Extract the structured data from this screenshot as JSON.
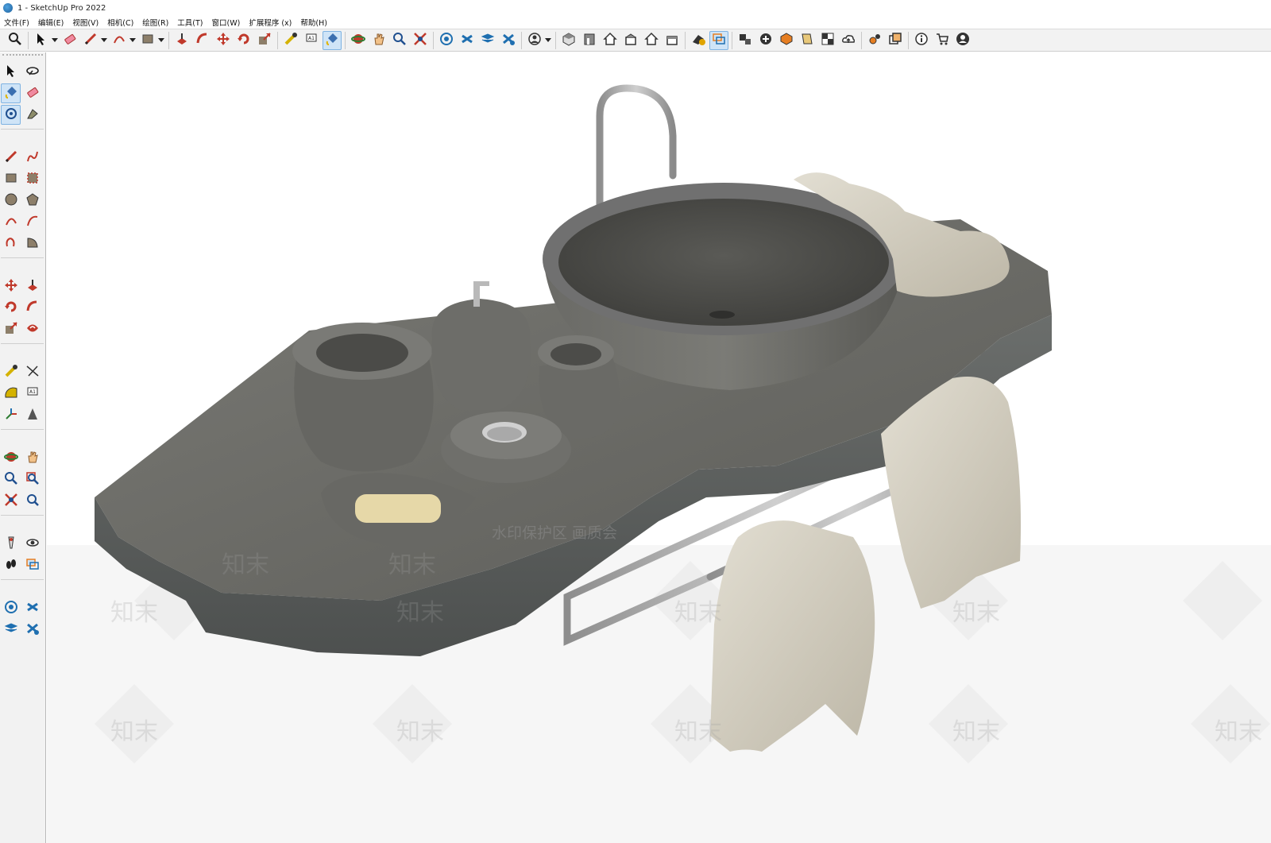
{
  "window": {
    "title": "1 - SketchUp Pro 2022"
  },
  "menu": [
    {
      "label": "文件(F)"
    },
    {
      "label": "编辑(E)"
    },
    {
      "label": "视图(V)"
    },
    {
      "label": "相机(C)"
    },
    {
      "label": "绘图(R)"
    },
    {
      "label": "工具(T)"
    },
    {
      "label": "窗口(W)"
    },
    {
      "label": "扩展程序 (x)"
    },
    {
      "label": "帮助(H)"
    }
  ],
  "toolbar": {
    "buttons": [
      {
        "icon": "zoom-search-icon"
      },
      {
        "icon": "select-arrow-icon",
        "dropdown": true
      },
      {
        "icon": "eraser-icon"
      },
      {
        "icon": "pencil-line-icon",
        "dropdown": true
      },
      {
        "icon": "arc-icon",
        "dropdown": true
      },
      {
        "icon": "rectangle-icon",
        "dropdown": true
      },
      {
        "icon": "push-pull-icon"
      },
      {
        "icon": "follow-me-icon"
      },
      {
        "icon": "move-icon"
      },
      {
        "icon": "rotate-icon"
      },
      {
        "icon": "scale-icon"
      },
      {
        "icon": "tape-measure-icon"
      },
      {
        "icon": "text-label-icon"
      },
      {
        "icon": "paint-bucket-icon",
        "active": true
      },
      {
        "icon": "orbit-icon"
      },
      {
        "icon": "pan-icon"
      },
      {
        "icon": "zoom-icon"
      },
      {
        "icon": "zoom-extents-icon"
      },
      {
        "icon": "warehouse-icon"
      },
      {
        "icon": "extension-warehouse-icon"
      },
      {
        "icon": "layout-icon"
      },
      {
        "icon": "extension-manager-icon"
      },
      {
        "icon": "account-icon",
        "dropdown": true
      },
      {
        "icon": "iso-view-icon"
      },
      {
        "icon": "front-view-icon"
      },
      {
        "icon": "top-view-icon"
      },
      {
        "icon": "right-view-icon"
      },
      {
        "icon": "back-view-icon"
      },
      {
        "icon": "left-view-icon"
      },
      {
        "icon": "xray-icon"
      },
      {
        "icon": "section-plane-icon",
        "active": true
      },
      {
        "icon": "section-display-icon"
      },
      {
        "icon": "add-location-icon"
      },
      {
        "icon": "terrain-icon"
      },
      {
        "icon": "photo-texture-icon"
      },
      {
        "icon": "checker-icon"
      },
      {
        "icon": "cloud-upload-icon"
      },
      {
        "icon": "settings-gear-icon"
      },
      {
        "icon": "window-icon"
      },
      {
        "icon": "info-icon"
      },
      {
        "icon": "cart-icon"
      },
      {
        "icon": "user-icon"
      }
    ]
  },
  "left_tools": [
    {
      "icon": "select-arrow-icon"
    },
    {
      "icon": "orbit-lasso-icon"
    },
    {
      "icon": "paint-bucket-icon",
      "active": true
    },
    {
      "icon": "eraser-icon"
    },
    {
      "icon": "component-icon",
      "active": true
    },
    {
      "icon": "tag-icon"
    },
    {
      "sep": true
    },
    {
      "icon": "pencil-line-icon"
    },
    {
      "icon": "freehand-icon"
    },
    {
      "icon": "rectangle-icon"
    },
    {
      "icon": "rotated-rectangle-icon"
    },
    {
      "icon": "circle-icon"
    },
    {
      "icon": "polygon-icon"
    },
    {
      "icon": "arc-icon"
    },
    {
      "icon": "two-point-arc-icon"
    },
    {
      "icon": "three-point-arc-icon"
    },
    {
      "icon": "pie-icon"
    },
    {
      "sep": true
    },
    {
      "icon": "move-icon"
    },
    {
      "icon": "push-pull-icon"
    },
    {
      "icon": "rotate-icon"
    },
    {
      "icon": "follow-me-icon"
    },
    {
      "icon": "scale-icon"
    },
    {
      "icon": "offset-icon"
    },
    {
      "sep": true
    },
    {
      "icon": "tape-measure-icon"
    },
    {
      "icon": "dimension-icon"
    },
    {
      "icon": "protractor-icon"
    },
    {
      "icon": "text-label-icon"
    },
    {
      "icon": "axes-icon"
    },
    {
      "icon": "3d-text-icon"
    },
    {
      "sep": true
    },
    {
      "icon": "orbit-icon"
    },
    {
      "icon": "pan-icon"
    },
    {
      "icon": "zoom-icon"
    },
    {
      "icon": "zoom-window-icon"
    },
    {
      "icon": "zoom-extents-icon"
    },
    {
      "icon": "previous-view-icon"
    },
    {
      "sep": true
    },
    {
      "icon": "position-camera-icon"
    },
    {
      "icon": "look-around-icon"
    },
    {
      "icon": "walk-icon"
    },
    {
      "icon": "section-plane-icon"
    },
    {
      "sep": true
    },
    {
      "icon": "warehouse-icon"
    },
    {
      "icon": "extension-warehouse-icon"
    },
    {
      "icon": "layout-icon"
    },
    {
      "icon": "extension-manager-icon"
    }
  ],
  "viewport": {
    "watermark_text": "水印保护区  画质会",
    "watermark_tile": "知末",
    "colors": {
      "stone": "#6f6f6a",
      "stone_dark": "#4a4a46",
      "towel": "#d9d4c6",
      "metal": "#a9a9a9",
      "soap": "#e6d8a8"
    }
  }
}
